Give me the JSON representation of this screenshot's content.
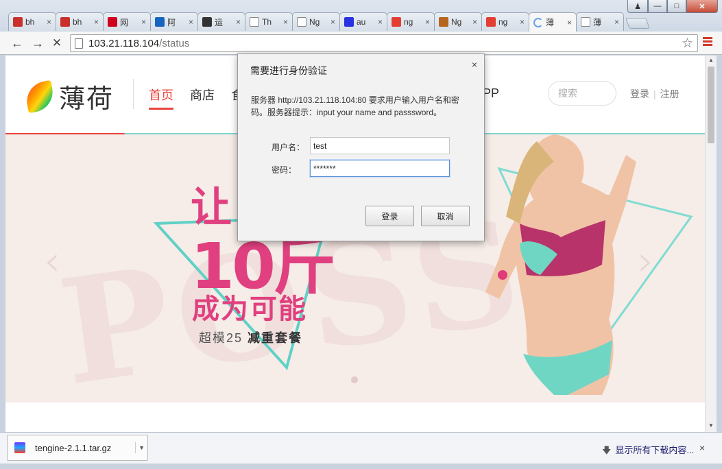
{
  "browser": {
    "tabs": [
      {
        "label": "bh",
        "icon": "zhihu-red-icon",
        "color": "#c9302c"
      },
      {
        "label": "bh",
        "icon": "zhihu-red-icon",
        "color": "#c9302c"
      },
      {
        "label": "网",
        "icon": "netease-icon",
        "color": "#d0021b"
      },
      {
        "label": "阿",
        "icon": "aliyun-icon",
        "color": "#1565c0"
      },
      {
        "label": "运",
        "icon": "ops-icon",
        "color": "#333333"
      },
      {
        "label": "Th",
        "icon": "page-icon",
        "color": "#888888"
      },
      {
        "label": "Ng",
        "icon": "page-icon",
        "color": "#888888"
      },
      {
        "label": "au",
        "icon": "baidu-paw-icon",
        "color": "#2932e1"
      },
      {
        "label": "ng",
        "icon": "csdn-c-icon",
        "color": "#e33e33"
      },
      {
        "label": "Ng",
        "icon": "blog-icon",
        "color": "#b5651d"
      },
      {
        "label": "ng",
        "icon": "csdn-c-icon",
        "color": "#e33e33"
      },
      {
        "label": "薄",
        "icon": "loading-spinner-icon",
        "color": "#6aa0e8",
        "active": true
      },
      {
        "label": "薄",
        "icon": "page-icon",
        "color": "#888888"
      }
    ],
    "tab_close": "×",
    "url_host": "103.21.118.104",
    "url_path": "/status"
  },
  "site": {
    "logo_text": "薄荷",
    "nav": [
      "首页",
      "商店",
      "食"
    ],
    "nav_app": "PP",
    "search_placeholder": "搜索",
    "login": "登录",
    "register": "注册"
  },
  "banner": {
    "line1": "让",
    "line2": "10斤",
    "line3": "成为可能",
    "line4_a": "超模25",
    "line4_b": "减重套餐",
    "bg_word": "POSS"
  },
  "dialog": {
    "title": "需要进行身份验证",
    "close": "×",
    "message": "服务器 http://103.21.118.104:80 要求用户输入用户名和密码。服务器提示：input your name and passsword。",
    "username_label": "用户名：",
    "username_value": "test",
    "password_label": "密码：",
    "password_value": "*******",
    "login_button": "登录",
    "cancel_button": "取消"
  },
  "downloads": {
    "file_name": "tengine-2.1.1.tar.gz",
    "show_all": "显示所有下载内容...",
    "close": "×"
  }
}
